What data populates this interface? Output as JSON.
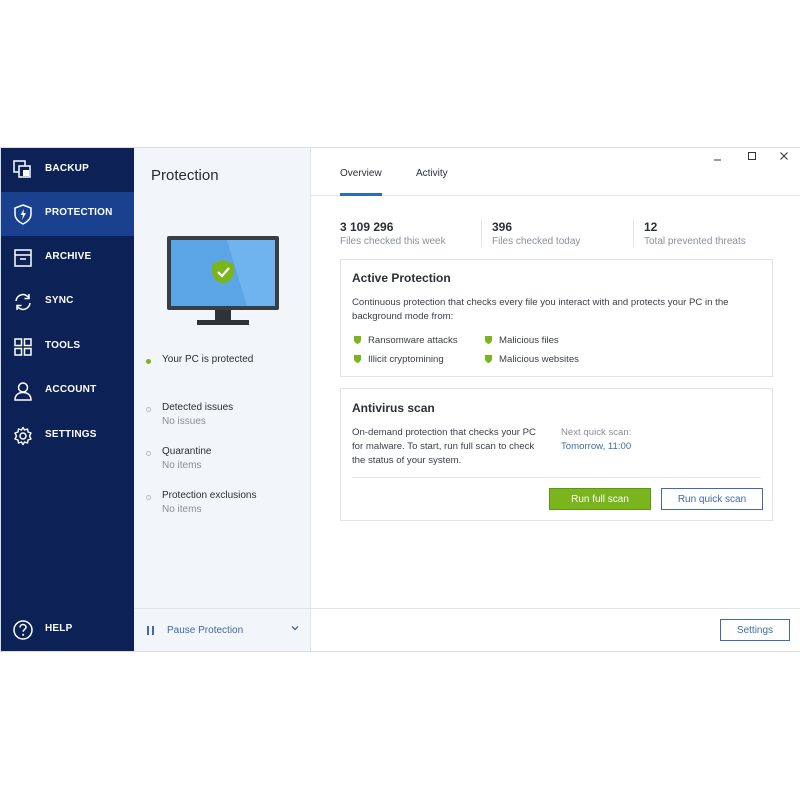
{
  "sidebar": {
    "items": [
      {
        "label": "BACKUP",
        "icon": "backup-icon"
      },
      {
        "label": "PROTECTION",
        "icon": "shield-icon",
        "active": true
      },
      {
        "label": "ARCHIVE",
        "icon": "archive-icon"
      },
      {
        "label": "SYNC",
        "icon": "sync-icon"
      },
      {
        "label": "TOOLS",
        "icon": "tools-icon"
      },
      {
        "label": "ACCOUNT",
        "icon": "account-icon"
      },
      {
        "label": "SETTINGS",
        "icon": "gear-icon"
      }
    ],
    "help": {
      "label": "HELP",
      "icon": "help-icon"
    }
  },
  "middle": {
    "title": "Protection",
    "status": "Your PC is protected",
    "rows": [
      {
        "title": "Detected issues",
        "value": "No issues"
      },
      {
        "title": "Quarantine",
        "value": "No items"
      },
      {
        "title": "Protection exclusions",
        "value": "No items"
      }
    ],
    "pause_label": "Pause Protection"
  },
  "tabs": [
    {
      "label": "Overview",
      "active": true
    },
    {
      "label": "Activity"
    }
  ],
  "stats": [
    {
      "value": "3 109 296",
      "label": "Files checked this week"
    },
    {
      "value": "396",
      "label": "Files checked today"
    },
    {
      "value": "12",
      "label": "Total prevented threats"
    }
  ],
  "active_protection": {
    "title": "Active Protection",
    "description_line1": "Continuous protection that checks every file you interact with and protects your PC in the",
    "description_line2": "background mode from:",
    "features": [
      "Ransomware attacks",
      "Malicious files",
      "Illicit cryptomining",
      "Malicious websites"
    ]
  },
  "antivirus": {
    "title": "Antivirus scan",
    "description_line1": "On-demand protection that checks your PC",
    "description_line2": "for malware. To start, run full scan to check",
    "description_line3": "the status of your system.",
    "next_scan_label": "Next quick scan:",
    "next_scan_value": "Tomorrow, 11:00",
    "run_full_scan": "Run full scan",
    "run_quick_scan": "Run quick scan"
  },
  "footer": {
    "settings_label": "Settings"
  },
  "colors": {
    "sidebar": "#0c2256",
    "sidebar_active": "#19418f",
    "accent_green": "#7ab51d",
    "accent_blue": "#3f6aa8"
  }
}
